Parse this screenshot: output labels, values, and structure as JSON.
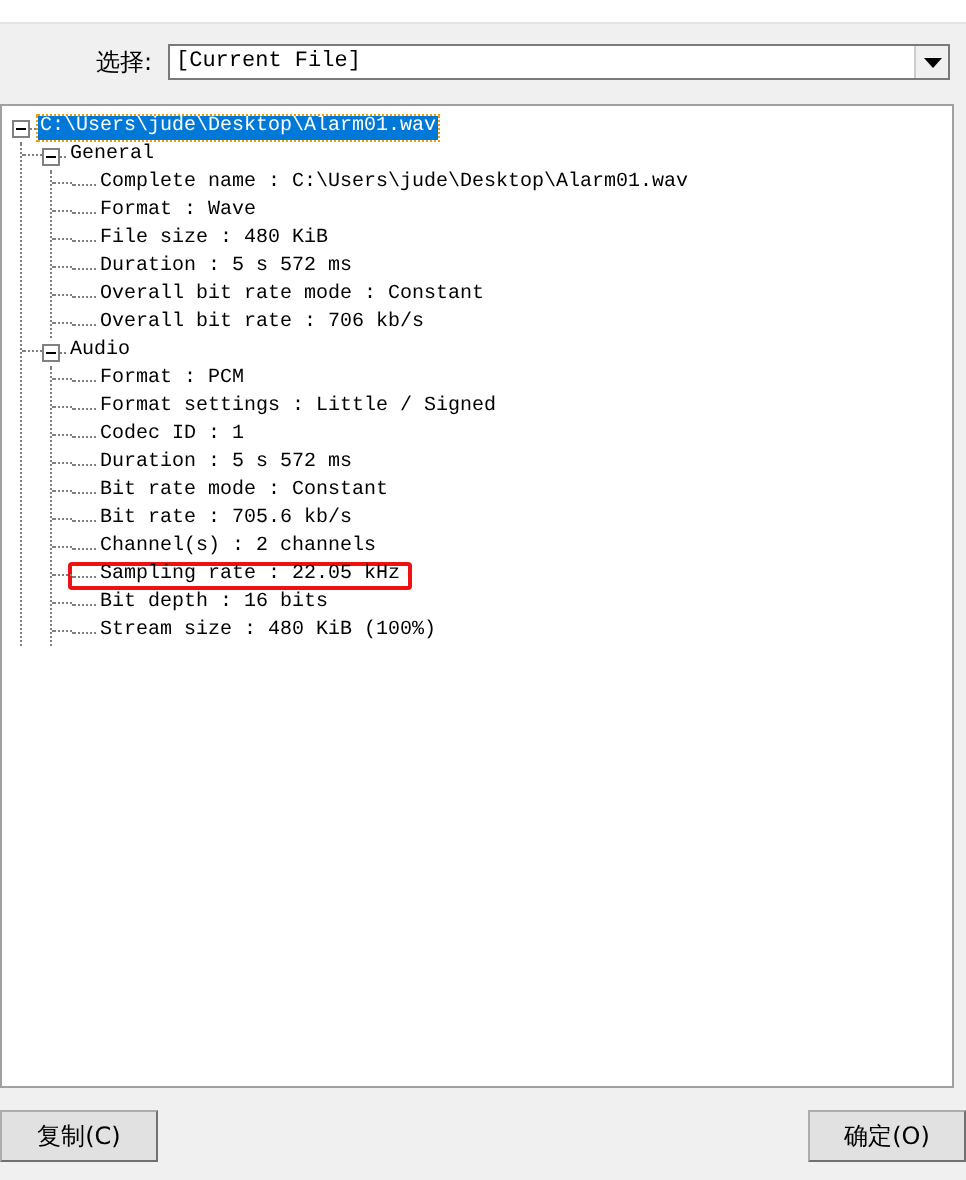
{
  "selector": {
    "label": "选择:",
    "value": "[Current File]"
  },
  "tree": [
    {
      "label": "C:\\Users\\jude\\Desktop\\Alarm01.wav",
      "selected": true,
      "expanded": true,
      "highlighted": false,
      "children": [
        {
          "label": "General",
          "selected": false,
          "expanded": true,
          "highlighted": false,
          "children": [
            {
              "label": "Complete name : C:\\Users\\jude\\Desktop\\Alarm01.wav",
              "selected": false,
              "highlighted": false
            },
            {
              "label": "Format : Wave",
              "selected": false,
              "highlighted": false
            },
            {
              "label": "File size : 480 KiB",
              "selected": false,
              "highlighted": false
            },
            {
              "label": "Duration : 5 s 572 ms",
              "selected": false,
              "highlighted": false
            },
            {
              "label": "Overall bit rate mode : Constant",
              "selected": false,
              "highlighted": false
            },
            {
              "label": "Overall bit rate : 706 kb/s",
              "selected": false,
              "highlighted": false
            }
          ]
        },
        {
          "label": "Audio",
          "selected": false,
          "expanded": true,
          "highlighted": false,
          "children": [
            {
              "label": "Format : PCM",
              "selected": false,
              "highlighted": false
            },
            {
              "label": "Format settings : Little / Signed",
              "selected": false,
              "highlighted": false
            },
            {
              "label": "Codec ID : 1",
              "selected": false,
              "highlighted": false
            },
            {
              "label": "Duration : 5 s 572 ms",
              "selected": false,
              "highlighted": false
            },
            {
              "label": "Bit rate mode : Constant",
              "selected": false,
              "highlighted": false
            },
            {
              "label": "Bit rate : 705.6 kb/s",
              "selected": false,
              "highlighted": false
            },
            {
              "label": "Channel(s) : 2 channels",
              "selected": false,
              "highlighted": false
            },
            {
              "label": "Sampling rate : 22.05 kHz",
              "selected": false,
              "highlighted": true
            },
            {
              "label": "Bit depth : 16 bits",
              "selected": false,
              "highlighted": false
            },
            {
              "label": "Stream size : 480 KiB (100%)",
              "selected": false,
              "highlighted": false
            }
          ]
        }
      ]
    }
  ],
  "buttons": [
    {
      "label": "复制(C)"
    },
    {
      "label": "确定(O)"
    }
  ]
}
